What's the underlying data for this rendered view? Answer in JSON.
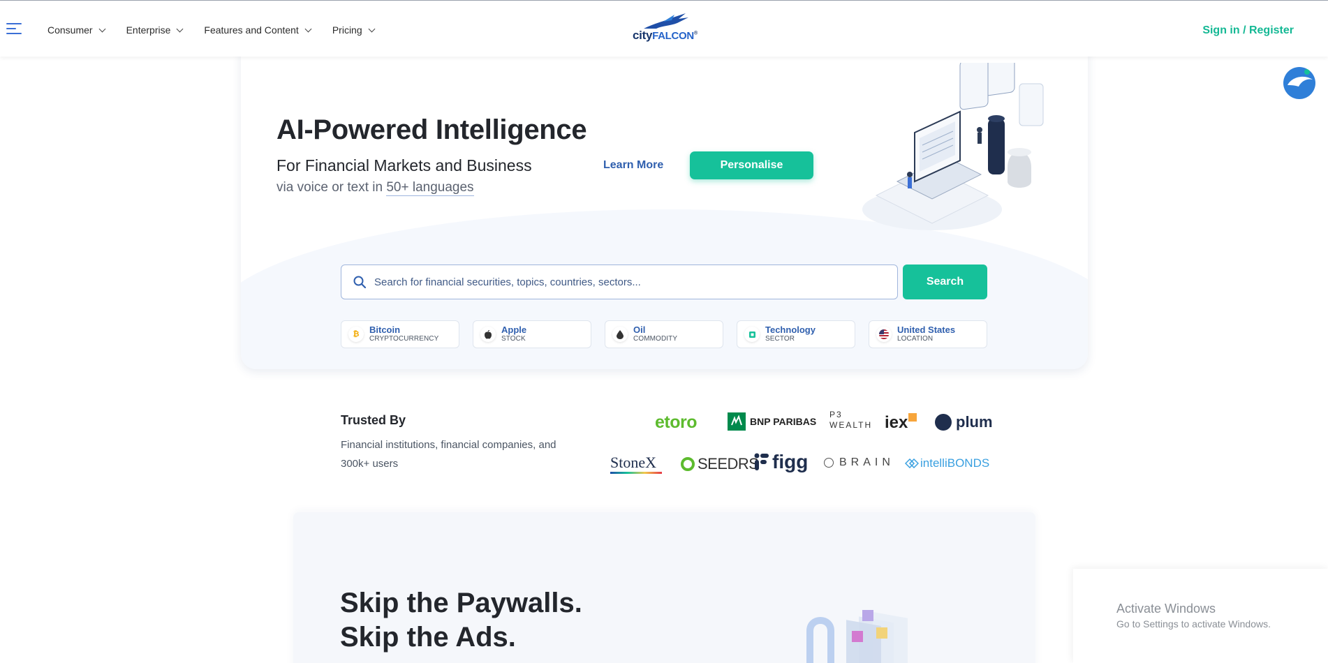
{
  "nav": {
    "menu": [
      {
        "label": "Consumer"
      },
      {
        "label": "Enterprise"
      },
      {
        "label": "Features and Content"
      },
      {
        "label": "Pricing"
      }
    ],
    "logo_city": "city",
    "logo_falcon": "FALCON",
    "logo_mark": "®",
    "signin": "Sign in / Register"
  },
  "hero": {
    "title": "AI-Powered Intelligence",
    "subtitle": "For Financial Markets and Business",
    "sub2_prefix": "via voice or text in ",
    "sub2_link": "50+ languages",
    "learn_more": "Learn More",
    "personalise": "Personalise"
  },
  "search": {
    "placeholder": "Search for financial securities, topics, countries, sectors...",
    "button": "Search"
  },
  "chips": [
    {
      "name": "Bitcoin",
      "type": "CRYPTOCURRENCY",
      "icon": "bitcoin-icon",
      "glyph": "₿",
      "color": "#f2a900"
    },
    {
      "name": "Apple",
      "type": "STOCK",
      "icon": "apple-icon",
      "glyph": "",
      "color": "#333333"
    },
    {
      "name": "Oil",
      "type": "COMMODITY",
      "icon": "oil-drop-icon",
      "glyph": "",
      "color": "#333333"
    },
    {
      "name": "Technology",
      "type": "SECTOR",
      "icon": "chip-icon",
      "glyph": "",
      "color": "#16c19a"
    },
    {
      "name": "United States",
      "type": "LOCATION",
      "icon": "us-flag-icon",
      "glyph": "",
      "color": "#b22234"
    }
  ],
  "trusted": {
    "title": "Trusted By",
    "description": "Financial institutions, financial companies, and 300k+ users",
    "logos": [
      "etoro",
      "BNP PARIBAS",
      "P3 WEALTH",
      "iex",
      "plum",
      "StoneX",
      "SEEDRS",
      "figg",
      "BRAIN",
      "intelliBONDS"
    ]
  },
  "paywall": {
    "line1": "Skip the Paywalls.",
    "line2": "Skip the Ads."
  },
  "windows": {
    "title": "Activate Windows",
    "subtitle": "Go to Settings to activate Windows."
  },
  "colors": {
    "accent": "#16c19a",
    "link": "#2f5fae",
    "brand_dark": "#17356b"
  }
}
